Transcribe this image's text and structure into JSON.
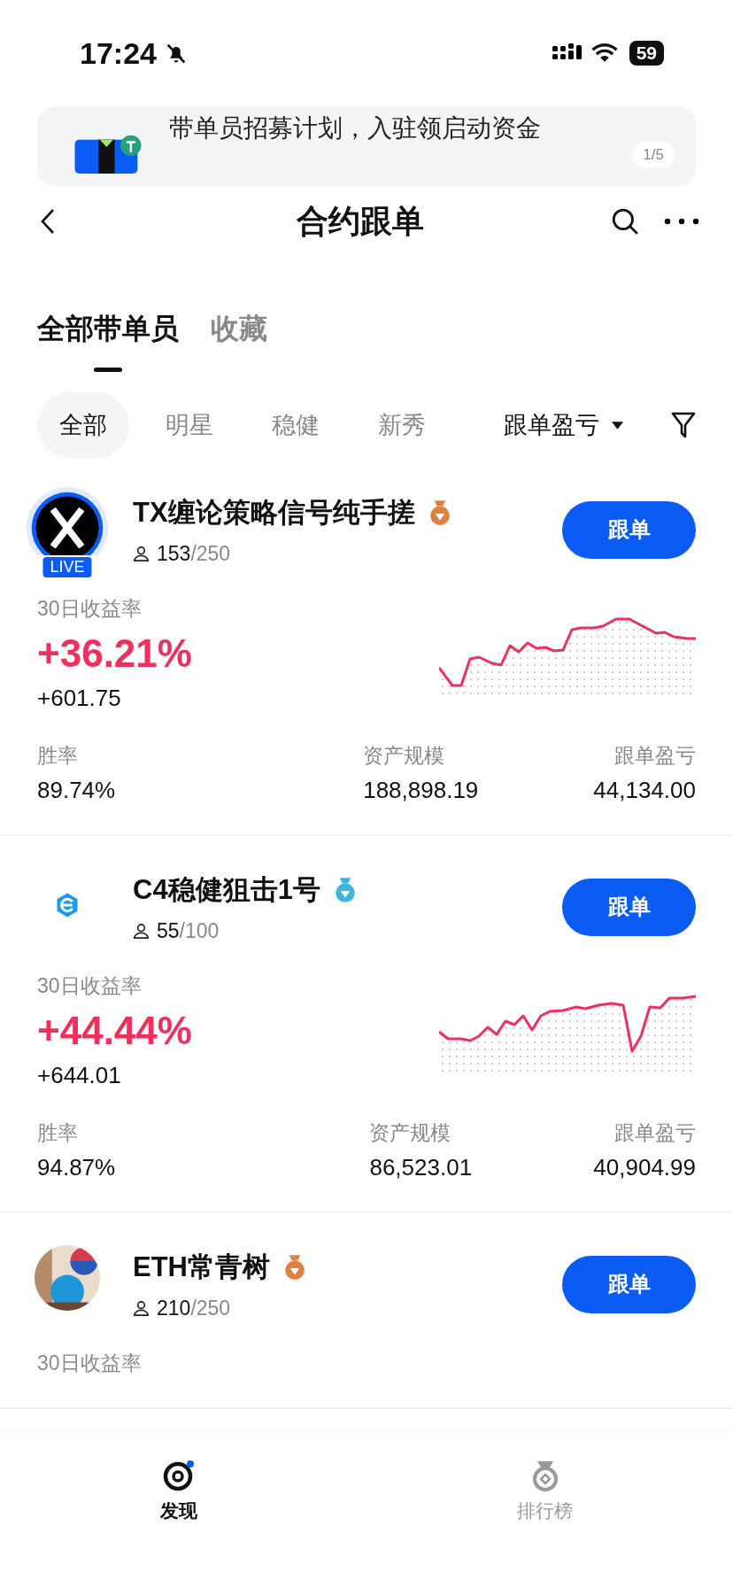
{
  "status_bar": {
    "time": "17:24",
    "battery": "59"
  },
  "header": {
    "title": "合约跟单"
  },
  "banner": {
    "text": "带单员招募计划，入驻领启动资金",
    "pager": "1/5"
  },
  "tabs": [
    {
      "label": "全部带单员",
      "selected": true
    },
    {
      "label": "收藏",
      "selected": false
    }
  ],
  "filters": [
    {
      "label": "全部",
      "selected": true
    },
    {
      "label": "明星",
      "selected": false
    },
    {
      "label": "稳健",
      "selected": false
    },
    {
      "label": "新秀",
      "selected": false
    }
  ],
  "sort": {
    "label": "跟单盈亏"
  },
  "traders": [
    {
      "name": "TX缠论策略信号纯手搓",
      "avatar": {
        "kind": "x-logo"
      },
      "live": true,
      "live_label": "LIVE",
      "color": "#e0803e",
      "followers": "153",
      "capacity": "/250",
      "button": "跟单",
      "return_label": "30日收益率",
      "return_pct": "+36.21%",
      "pnl": "+601.75",
      "stats": [
        {
          "label": "胜率",
          "value": "89.74%"
        },
        {
          "label": "资产规模",
          "value": "188,898.19"
        },
        {
          "label": "跟单盈亏",
          "value": "44,134.00"
        }
      ]
    },
    {
      "name": "C4稳健狙击1号",
      "avatar": {
        "kind": "c-logo"
      },
      "live": false,
      "color": "#3fb4df",
      "followers": "55",
      "capacity": "/100",
      "button": "跟单",
      "return_label": "30日收益率",
      "return_pct": "+44.44%",
      "pnl": "+644.01",
      "stats": [
        {
          "label": "胜率",
          "value": "94.87%"
        },
        {
          "label": "资产规模",
          "value": "86,523.01"
        },
        {
          "label": "跟单盈亏",
          "value": "40,904.99"
        }
      ]
    },
    {
      "name": "ETH常青树",
      "live": false,
      "color": "#e0803e",
      "followers": "210",
      "capacity": "/250",
      "button": "跟单",
      "return_label": "30日收益率"
    }
  ],
  "bottom_nav": [
    {
      "label": "发现",
      "selected": true
    },
    {
      "label": "排行榜",
      "selected": false
    }
  ]
}
